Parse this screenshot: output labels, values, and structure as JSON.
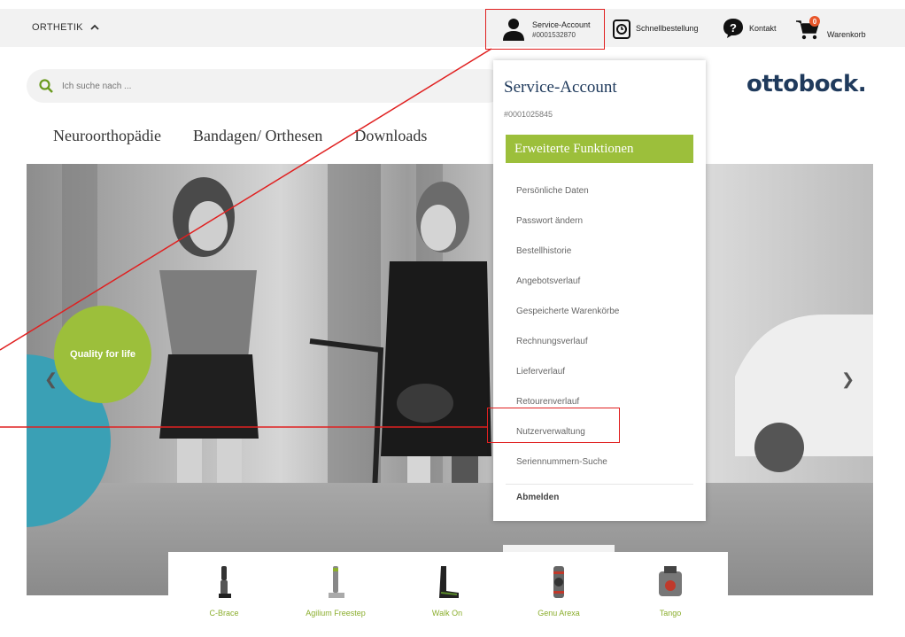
{
  "topbar": {
    "brand_menu": "ORTHETIK",
    "service_account": {
      "label": "Service-Account",
      "number": "#0001532870"
    },
    "quick_order": "Schnellbestellung",
    "contact": "Kontakt",
    "cart": {
      "label": "Warenkorb",
      "count": "0"
    }
  },
  "search": {
    "placeholder": "Ich suche nach ..."
  },
  "logo": "ottobock.",
  "mainnav": {
    "items": [
      "Neuroorthopädie",
      "Bandagen/ Orthesen",
      "Downloads"
    ]
  },
  "hero": {
    "badge": "Quality for life"
  },
  "products": {
    "items": [
      "C-Brace",
      "Agilium Freestep",
      "Walk On",
      "Genu Arexa",
      "Tango"
    ]
  },
  "dropdown": {
    "title": "Service-Account",
    "number": "#0001025845",
    "extended": "Erweiterte Funktionen",
    "items": [
      "Persönliche Daten",
      "Passwort ändern",
      "Bestellhistorie",
      "Angebotsverlauf",
      "Gespeicherte Warenkörbe",
      "Rechnungsverlauf",
      "Lieferverlauf",
      "Retourenverlauf",
      "Nutzerverwaltung",
      "Seriennummern-Suche"
    ],
    "logout": "Abmelden"
  },
  "colors": {
    "accent_green": "#9cbf3b",
    "brand_blue": "#1f3a5c",
    "annotation_red": "#e02020",
    "teal": "#3aa0b5"
  }
}
